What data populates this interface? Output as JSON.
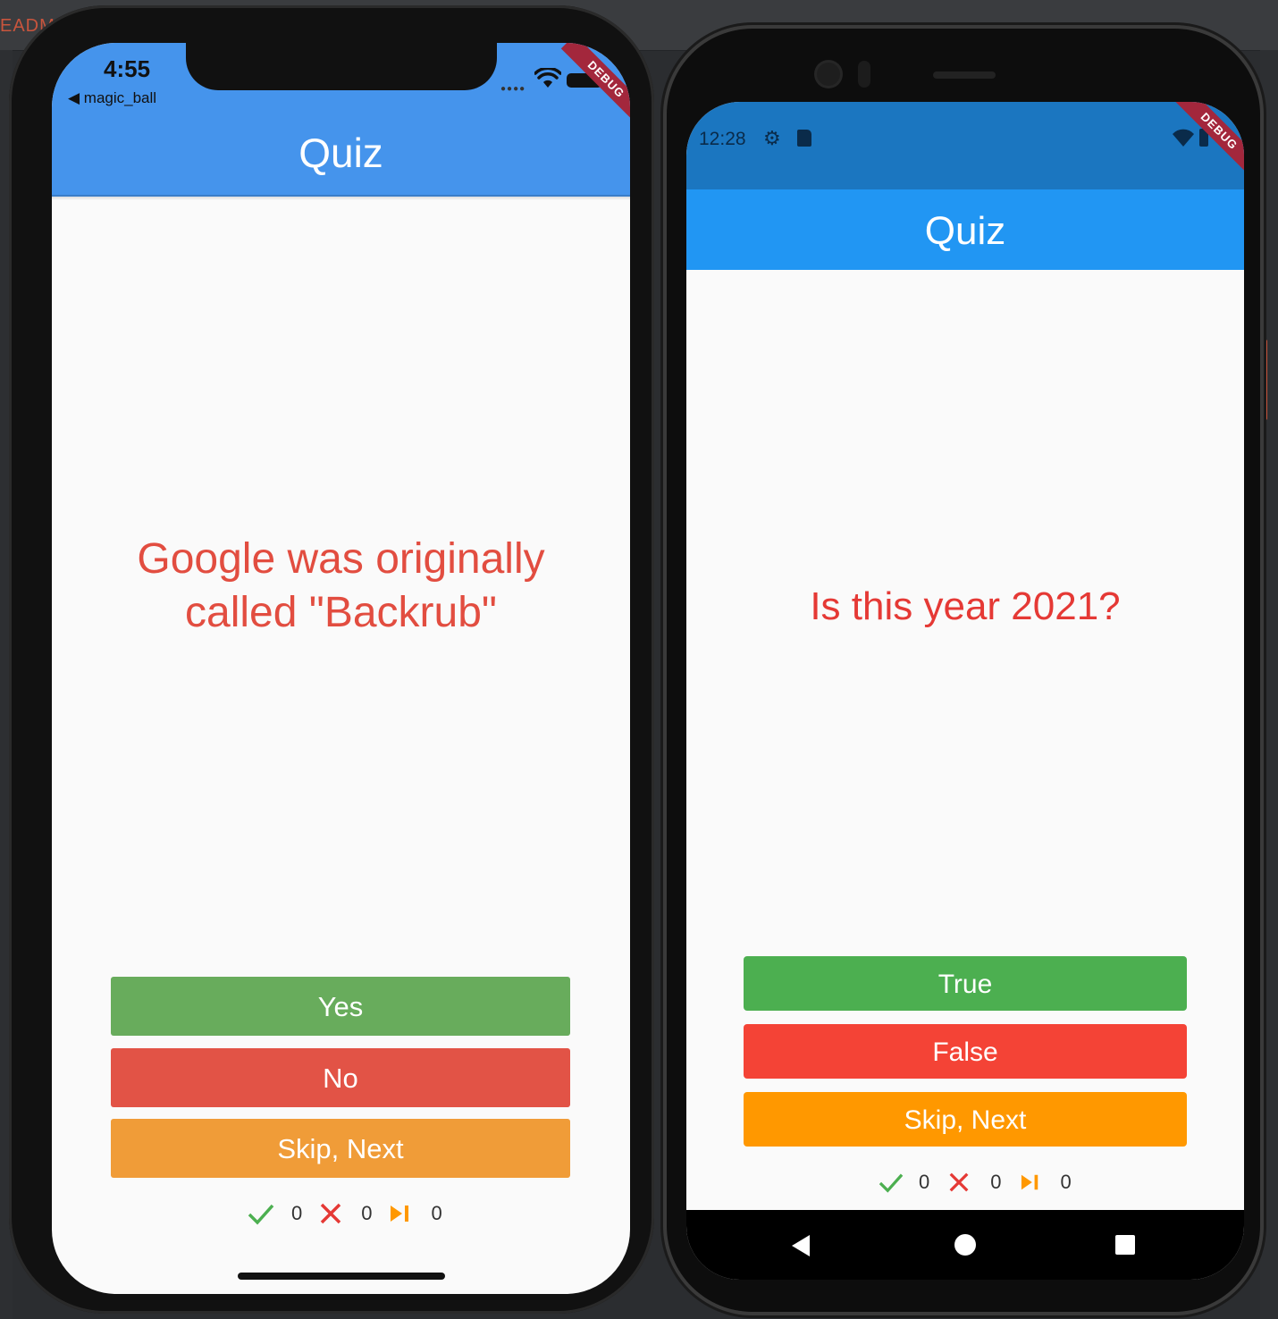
{
  "ide": {
    "tab_label": "EADM"
  },
  "ios": {
    "status": {
      "time": "4:55",
      "back_label": "◀ magic_ball"
    },
    "debug_label": "DEBUG",
    "app_title": "Quiz",
    "question": "Google was originally called \"Backrub\"",
    "buttons": {
      "yes": "Yes",
      "no": "No",
      "skip": "Skip, Next"
    },
    "colors": {
      "appbar": "#4594ec",
      "yes": "#68ac5c",
      "no": "#e25346",
      "skip": "#f09c38",
      "question": "#e24d40"
    },
    "score": {
      "correct": "0",
      "wrong": "0",
      "skipped": "0"
    }
  },
  "android": {
    "status": {
      "time": "12:28"
    },
    "debug_label": "DEBUG",
    "app_title": "Quiz",
    "question": "Is this year 2021?",
    "buttons": {
      "true": "True",
      "false": "False",
      "skip": "Skip, Next"
    },
    "colors": {
      "appbar": "#2196f3",
      "true": "#4caf50",
      "false": "#f44336",
      "skip": "#ff9800",
      "question": "#e53935"
    },
    "score": {
      "correct": "0",
      "wrong": "0",
      "skipped": "0"
    }
  }
}
